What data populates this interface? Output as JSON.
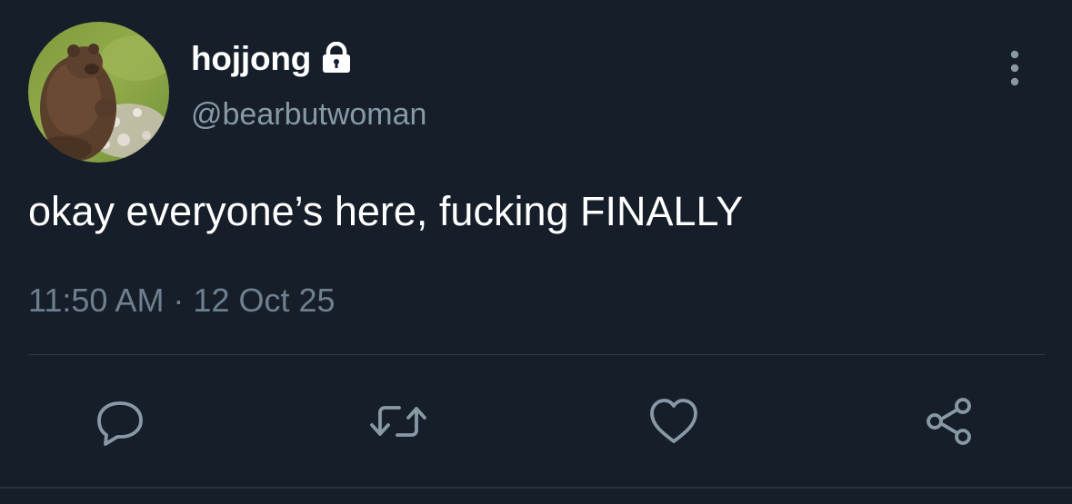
{
  "tweet": {
    "display_name": "hojjong",
    "handle": "@bearbutwoman",
    "text": "okay everyone’s here, fucking FINALLY",
    "timestamp": "11:50 AM · 12 Oct 25",
    "protected": true
  },
  "icons": {
    "avatar": "avatar-bear-photo",
    "lock": "lock-icon",
    "more": "more-vertical-icon",
    "reply": "reply-icon",
    "retweet": "retweet-icon",
    "like": "heart-icon",
    "share": "share-icon"
  },
  "colors": {
    "background": "#151e29",
    "primary_text": "#ffffff",
    "secondary_text": "#8899a6",
    "icon_gray": "#8899a6",
    "divider": "#2f3b47"
  }
}
